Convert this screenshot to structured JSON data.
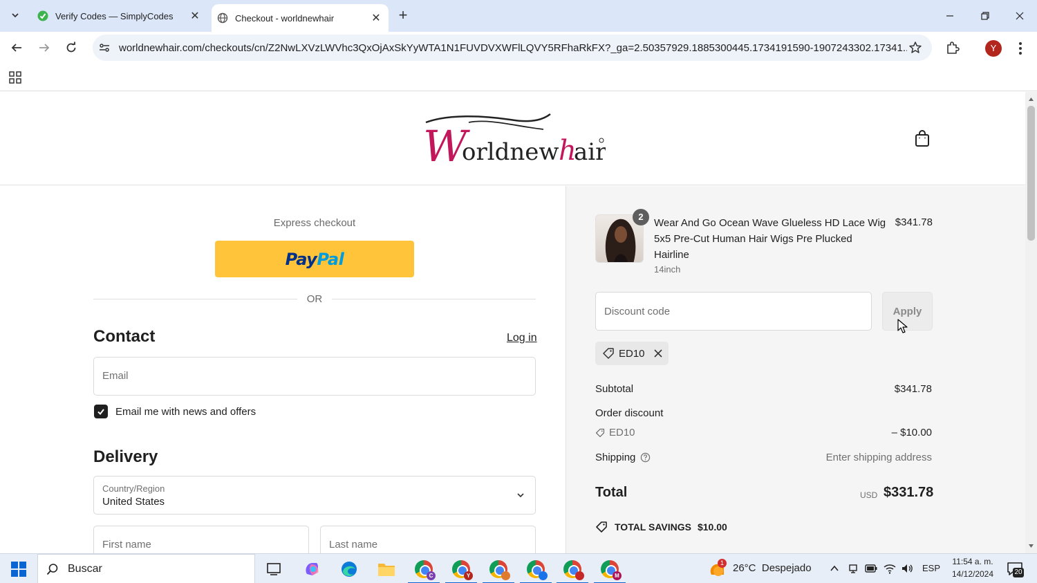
{
  "browser": {
    "tabs": [
      {
        "title": "Verify Codes — SimplyCodes",
        "active": false
      },
      {
        "title": "Checkout - worldnewhair",
        "active": true
      }
    ],
    "url": "worldnewhair.com/checkouts/cn/Z2NwLXVzLWVhc3QxOjAxSkYyWTA1N1FUVDVXWFlLQVY5RFhaRkFX?_ga=2.50357929.1885300445.1734191590-1907243302.17341...",
    "profile_initial": "Y"
  },
  "header": {
    "logo_text": "Worldnewhair"
  },
  "checkout": {
    "express_label": "Express checkout",
    "paypal_label": "PayPal",
    "or_label": "OR",
    "contact_heading": "Contact",
    "login_label": "Log in",
    "email_placeholder": "Email",
    "newsletter_label": "Email me with news and offers",
    "newsletter_checked": true,
    "delivery_heading": "Delivery",
    "country_label": "Country/Region",
    "country_value": "United States",
    "first_name_placeholder": "First name",
    "last_name_placeholder": "Last name"
  },
  "summary": {
    "product": {
      "name": "Wear And Go Ocean Wave Glueless HD Lace Wig 5x5 Pre-Cut Human Hair Wigs Pre Plucked Hairline",
      "variant": "14inch",
      "price": "$341.78",
      "quantity": "2"
    },
    "discount_placeholder": "Discount code",
    "apply_label": "Apply",
    "applied_code": "ED10",
    "subtotal_label": "Subtotal",
    "subtotal_value": "$341.78",
    "order_discount_label": "Order discount",
    "discount_code_label": "ED10",
    "discount_value": "– $10.00",
    "shipping_label": "Shipping",
    "shipping_value": "Enter shipping address",
    "total_label": "Total",
    "total_currency": "USD",
    "total_value": "$331.78",
    "savings_label": "TOTAL SAVINGS",
    "savings_value": "$10.00"
  },
  "taskbar": {
    "search_label": "Buscar",
    "weather_temp": "26°C",
    "weather_desc": "Despejado",
    "weather_badge": "1",
    "language": "ESP",
    "time": "11:54 a. m.",
    "date": "14/12/2024",
    "notifications": "20",
    "chrome_profiles": [
      "C",
      "Y",
      "",
      "",
      "",
      "M"
    ]
  },
  "colors": {
    "paypal_yellow": "#ffc439",
    "logo_pink": "#c2185b",
    "tabstrip_bg": "#dbe6f8",
    "summary_bg": "#f5f5f5"
  }
}
